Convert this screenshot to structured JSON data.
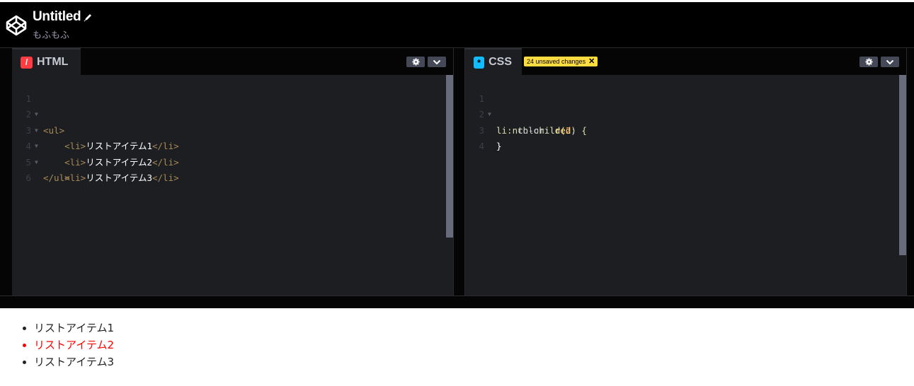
{
  "header": {
    "title": "Untitled",
    "subtitle": "もふもふ",
    "logo_icon": "codepen-logo-icon",
    "edit_icon": "pencil-icon"
  },
  "editors": {
    "html": {
      "label": "HTML",
      "icon": "html-slash-icon",
      "icon_color": "#ff3c41",
      "lines": [
        {
          "n": "1"
        },
        {
          "n": "2"
        },
        {
          "n": "3"
        },
        {
          "n": "4"
        },
        {
          "n": "5"
        },
        {
          "n": "6"
        }
      ],
      "code": {
        "l1_tag": "<ul>",
        "l2_open": "<li>",
        "l2_text": "リストアイテム1",
        "l2_close": "</li>",
        "l3_open": "<li>",
        "l3_text": "リストアイテム2",
        "l3_close": "</li>",
        "l4_open": "<li>",
        "l4_text": "リストアイテム3",
        "l4_close": "</li>",
        "l5_tag": "</ul>"
      },
      "tools": {
        "settings_icon": "gear-icon",
        "collapse_icon": "chevron-down-icon"
      }
    },
    "css": {
      "label": "CSS",
      "icon": "asterisk-icon",
      "icon_color": "#0ebeff",
      "badge": "24 unsaved changes",
      "badge_close": "✕",
      "lines": [
        {
          "n": "1"
        },
        {
          "n": "2"
        },
        {
          "n": "3"
        },
        {
          "n": "4"
        }
      ],
      "code": {
        "l1_sel": "li:nth-child(",
        "l1_num": "2",
        "l1_end": ") {",
        "l2_prop": "color",
        "l2_colon": ": ",
        "l2_val": "red",
        "l2_semi": ";",
        "l3": "}"
      },
      "tools": {
        "settings_icon": "gear-icon",
        "collapse_icon": "chevron-down-icon"
      }
    }
  },
  "preview": {
    "items": [
      "リストアイテム1",
      "リストアイテム2",
      "リストアイテム3"
    ],
    "highlight_color": "#ff0000"
  }
}
